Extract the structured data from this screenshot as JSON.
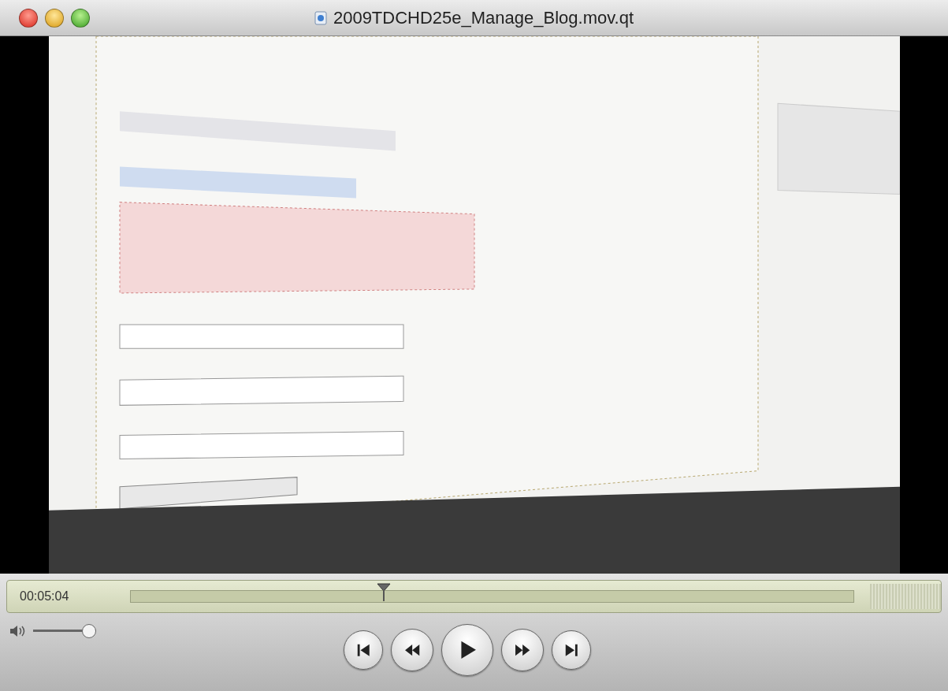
{
  "window": {
    "title": "2009TDCHD25e_Manage_Blog.mov.qt"
  },
  "timeline": {
    "time": "00:05:04",
    "level": 0.35
  },
  "volume": {
    "level": 1
  },
  "transport": [
    {
      "kind": "start"
    },
    {
      "kind": "rewind"
    },
    {
      "kind": "play"
    },
    {
      "kind": "forward"
    },
    {
      "kind": "end"
    }
  ]
}
